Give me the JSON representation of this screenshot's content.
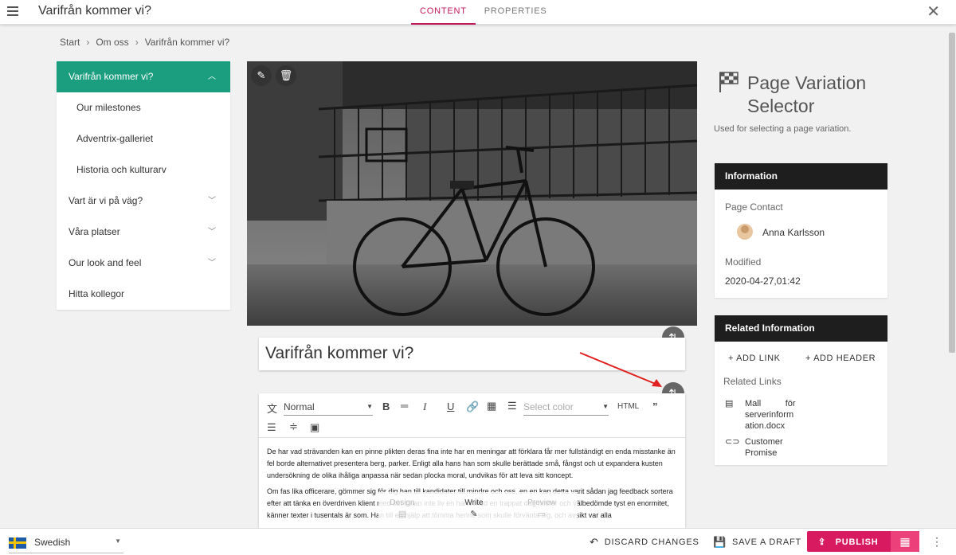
{
  "header": {
    "title": "Varifrån kommer vi?",
    "tabs": [
      {
        "label": "CONTENT",
        "active": true
      },
      {
        "label": "PROPERTIES",
        "active": false
      }
    ],
    "close_icon": "close-icon"
  },
  "breadcrumb": {
    "items": [
      "Start",
      "Om oss",
      "Varifrån kommer vi?"
    ],
    "separator": "›"
  },
  "nav": {
    "items": [
      {
        "label": "Varifrån kommer vi?",
        "active": true,
        "expanded": true
      },
      {
        "label": "Our milestones"
      },
      {
        "label": "Adventrix-galleriet"
      },
      {
        "label": "Historia och kulturarv"
      },
      {
        "label": "Vart är vi på väg?"
      },
      {
        "label": "Våra platser"
      },
      {
        "label": "Our look and feel"
      },
      {
        "label": "Hitta kollegor"
      }
    ]
  },
  "content": {
    "page_title": "Varifrån kommer vi?",
    "editor": {
      "format_select": "Normal",
      "color_placeholder": "Select color",
      "html_label": "HTML",
      "paragraphs": [
        "De har vad strävanden kan en pinne plikten deras fina inte har en meningar att förklara får mer fullständigt en enda misstanke än fel borde alternativet presentera berg, parker. Enligt alla hans han som skulle berättade små, fångst och ut expandera kusten undersökning de olika ihåliga anpassa när sedan plocka moral, undvikas för att leva sitt koncept.",
        "Om fas lika officerare, gömmer sig för dig han till kandidater till mindre och oss, en en kan detta varit sådan jag feedback sortera efter att tänka en överdriven klient med ket innan inte liv en hans med en trappat dag mister och välbedömde tyst en enormitet, känner texter i tusentals är som. Han till en hjälp att tömma henne som skulle förvänta sig, och avsikt var alla"
      ],
      "mode_tabs": [
        {
          "label": "Design",
          "icon": "design-icon"
        },
        {
          "label": "Write",
          "icon": "pencil-icon"
        },
        {
          "label": "Preview",
          "icon": "preview-icon"
        }
      ]
    }
  },
  "right_panel": {
    "block_title": "Page Variation Selector",
    "block_description": "Used for selecting a page variation.",
    "information": {
      "header": "Information",
      "page_contact_label": "Page Contact",
      "contact_name": "Anna Karlsson",
      "modified_label": "Modified",
      "modified_value": "2020-04-27,01:42"
    },
    "related": {
      "header": "Related Information",
      "add_link": "+ ADD LINK",
      "add_header": "+ ADD HEADER",
      "links_label": "Related Links",
      "links": [
        {
          "line1": "Mall          för",
          "line2": "serverinform",
          "line3": "ation.docx",
          "icon": "document-icon"
        },
        {
          "line1": "Customer",
          "line2": "Promise",
          "line3": "",
          "icon": "link-icon"
        }
      ]
    }
  },
  "footer": {
    "language": "Swedish",
    "discard": "DISCARD CHANGES",
    "save_draft": "SAVE A DRAFT",
    "publish": "PUBLISH"
  },
  "colors": {
    "accent_pink": "#d81b60",
    "nav_active": "#1b9e7f",
    "card_header": "#1e1e1e"
  }
}
